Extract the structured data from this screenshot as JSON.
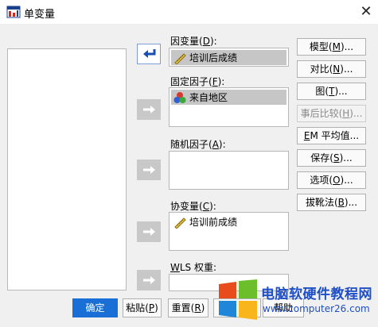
{
  "window": {
    "title": "单变量"
  },
  "fields": {
    "dependent": {
      "label": "因变量",
      "hotkey": "D",
      "suffix": "):",
      "items": [
        "培训后成绩"
      ]
    },
    "fixed": {
      "label": "固定因子",
      "hotkey": "F",
      "suffix": "):",
      "items": [
        "来自地区"
      ]
    },
    "random": {
      "label": "随机因子",
      "hotkey": "A",
      "suffix": "):",
      "items": []
    },
    "covariate": {
      "label": "协变量",
      "hotkey": "C",
      "suffix": "):",
      "items": [
        "培训前成绩"
      ]
    },
    "wls": {
      "hotkey": "W",
      "rest": "LS 权重:"
    }
  },
  "side_buttons": [
    {
      "text": "模型",
      "hotkey": "M",
      "tail": ")...",
      "enabled": true
    },
    {
      "text": "对比",
      "hotkey": "N",
      "tail": ")...",
      "enabled": true
    },
    {
      "text": "图",
      "hotkey": "T",
      "tail": ")...",
      "enabled": true
    },
    {
      "text": "事后比较",
      "hotkey": "H",
      "tail": ")...",
      "enabled": false
    },
    {
      "pre": "",
      "hotkey": "E",
      "rest": "M 平均值...",
      "enabled": true
    },
    {
      "text": "保存",
      "hotkey": "S",
      "tail": ")...",
      "enabled": true
    },
    {
      "text": "选项",
      "hotkey": "O",
      "tail": ")...",
      "enabled": true
    },
    {
      "text": "拔靴法",
      "hotkey": "B",
      "tail": ")...",
      "enabled": true
    }
  ],
  "bottom_buttons": {
    "ok": "确定",
    "paste": {
      "text": "粘贴",
      "hotkey": "P",
      "tail": ")"
    },
    "reset": {
      "text": "重置",
      "hotkey": "R",
      "tail": ")"
    },
    "help": "帮助"
  },
  "watermark": {
    "line1": "电脑软硬件教程网",
    "line2": "www.computer26.com"
  },
  "colors": {
    "primary_button": "#1a6fd6",
    "selection": "#c6c6c6",
    "watermark_text": "#1e4fc7"
  }
}
